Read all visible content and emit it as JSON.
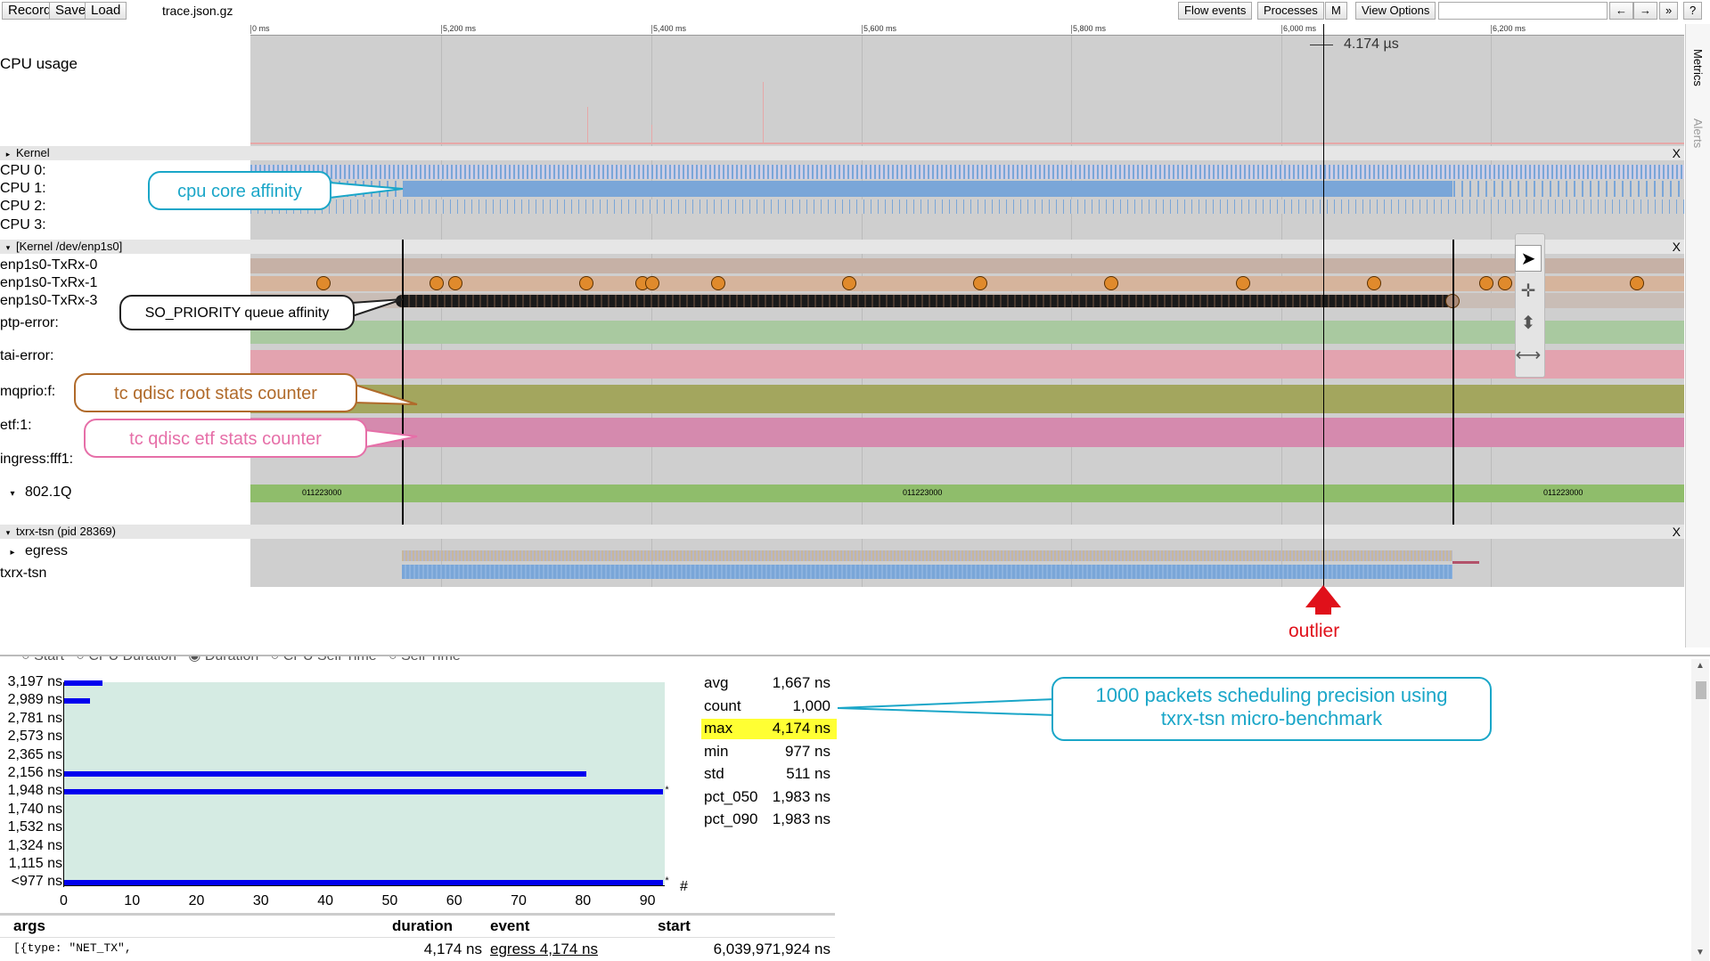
{
  "toolbar": {
    "record_label": "Record",
    "save_label": "Save",
    "load_label": "Load",
    "filename": "trace.json.gz",
    "flow_events_label": "Flow events",
    "processes_label": "Processes",
    "m_label": "M",
    "view_options_label": "View Options",
    "search_value": "",
    "nav_left": "←",
    "nav_right": "→",
    "nav_more": "»",
    "help": "?"
  },
  "ruler": {
    "ticks": [
      "0 ms",
      "5,200 ms",
      "5,400 ms",
      "5,600 ms",
      "5,800 ms",
      "6,000 ms",
      "6,200 ms"
    ],
    "measure_label": "4.174 µs"
  },
  "tracks": {
    "cpu_usage": "CPU usage",
    "kernel_header": "Kernel",
    "cpu0": "CPU 0:",
    "cpu1": "CPU 1:",
    "cpu2": "CPU 2:",
    "cpu3": "CPU 3:",
    "enp_header": "[Kernel /dev/enp1s0]",
    "txrx0": "enp1s0-TxRx-0",
    "txrx1": "enp1s0-TxRx-1",
    "txrx3": "enp1s0-TxRx-3",
    "ptp_error": "ptp-error:",
    "tai_error": "tai-error:",
    "mqprio": "mqprio:f:",
    "etf": "etf:1:",
    "ingress": "ingress:fff1:",
    "vlan": "802.1Q",
    "vlan_values": [
      "011223000",
      "011223000",
      "011223000"
    ],
    "proc_header": "txrx-tsn (pid 28369)",
    "egress": "egress",
    "txrx_tsn": "txrx-tsn",
    "close": "X"
  },
  "side_tabs": {
    "metrics": "Metrics",
    "alerts": "Alerts"
  },
  "callouts": {
    "cpu": "cpu core affinity",
    "so_priority": "SO_PRIORITY queue affinity",
    "root_stats": "tc qdisc root stats counter",
    "etf_stats": "tc qdisc etf stats counter",
    "outlier": "outlier",
    "packets_line1": "1000 packets scheduling precision using",
    "packets_line2": "txrx-tsn micro-benchmark"
  },
  "colors": {
    "cpu_blue": "#7aa6d8",
    "txrx_orange": "#e08a2c",
    "ptp_green": "#a9c9a0",
    "tai_pink": "#e3a3af",
    "mqprio_olive": "#a3a65e",
    "etf_magenta": "#d58aae",
    "vlan_green": "#8fbd6b",
    "hist_bar": "#0000ee",
    "hist_bg": "#d5ebe3",
    "callout_cyan": "#1aa6c8",
    "callout_brown": "#b06a2a",
    "callout_pink": "#e66fa8",
    "outlier_red": "#e0101a"
  },
  "histogram": {
    "radio_options": [
      "Start",
      "CPU Duration",
      "Duration",
      "CPU Self Time",
      "Self Time"
    ],
    "selected": "Duration",
    "y_labels": [
      "3,197 ns",
      "2,989 ns",
      "2,781 ns",
      "2,573 ns",
      "2,365 ns",
      "2,156 ns",
      "1,948 ns",
      "1,740 ns",
      "1,532 ns",
      "1,324 ns",
      "1,115 ns",
      "<977 ns"
    ],
    "x_ticks": [
      "0",
      "10",
      "20",
      "30",
      "40",
      "50",
      "60",
      "70",
      "80",
      "90"
    ],
    "x_unit": "#",
    "counts": [
      6,
      4,
      0,
      0,
      0,
      81,
      93,
      0,
      0,
      0,
      0,
      93
    ],
    "star": "*"
  },
  "chart_data": {
    "type": "bar",
    "orientation": "horizontal",
    "categories": [
      "3,197 ns",
      "2,989 ns",
      "2,781 ns",
      "2,573 ns",
      "2,365 ns",
      "2,156 ns",
      "1,948 ns",
      "1,740 ns",
      "1,532 ns",
      "1,324 ns",
      "1,115 ns",
      "<977 ns"
    ],
    "values": [
      6,
      4,
      0,
      0,
      0,
      81,
      93,
      0,
      0,
      0,
      0,
      93
    ],
    "xlabel": "#",
    "xlim": [
      0,
      93
    ]
  },
  "stats": [
    {
      "name": "avg",
      "value": "1,667 ns"
    },
    {
      "name": "count",
      "value": "1,000"
    },
    {
      "name": "max",
      "value": "4,174 ns"
    },
    {
      "name": "min",
      "value": "977 ns"
    },
    {
      "name": "std",
      "value": "511 ns"
    },
    {
      "name": "pct_050",
      "value": "1,983 ns"
    },
    {
      "name": "pct_090",
      "value": "1,983 ns"
    }
  ],
  "table": {
    "headers": {
      "args": "args",
      "duration": "duration",
      "event": "event",
      "start": "start"
    },
    "row": {
      "args": "[{type: \"NET_TX\",",
      "duration": "4,174 ns",
      "event": "egress 4,174 ns",
      "start": "6,039,971,924 ns"
    }
  }
}
